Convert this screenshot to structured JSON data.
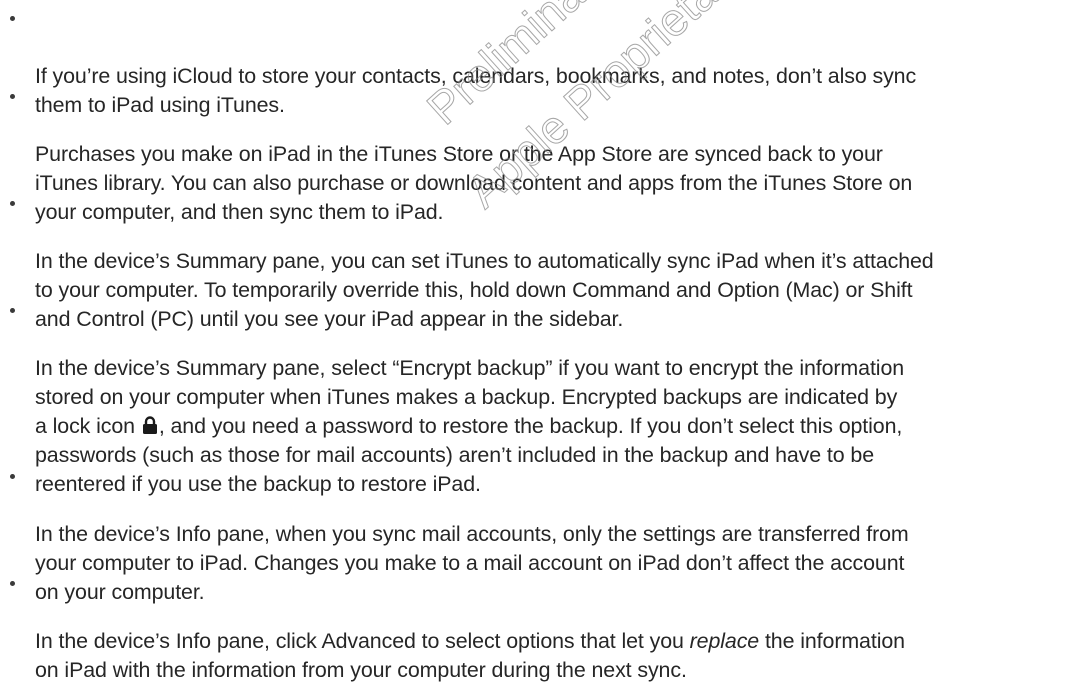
{
  "watermark": {
    "line1": "Preliminary",
    "line2": "Apple Proprietary"
  },
  "bullets": [
    {
      "text": "If you’re using iCloud to store your contacts, calendars, bookmarks, and notes, don’t also sync\nthem to iPad using iTunes."
    },
    {
      "text": "Purchases you make on iPad in the iTunes Store or the App Store are synced back to your\niTunes library. You can also purchase or download content and apps from the iTunes Store on\nyour computer, and then sync them to iPad."
    },
    {
      "text": "In the device’s Summary pane, you can set iTunes to automatically sync iPad when it’s attached\nto your computer. To temporarily override this, hold down Command and Option (Mac) or Shift\nand Control (PC) until you see your iPad appear in the sidebar."
    },
    {
      "text_before_icon": "In the device’s Summary pane, select “Encrypt backup” if you want to encrypt the information\nstored on your computer when iTunes makes a backup. Encrypted backups are indicated by\na lock icon ",
      "icon": "lock-icon",
      "text_after_icon": ", and you need a password to restore the backup. If you don’t select this option,\npasswords (such as those for mail accounts) aren’t included in the backup and have to be\nreentered if you use the backup to restore iPad."
    },
    {
      "text": "In the device’s Info pane, when you sync mail accounts, only the settings are transferred from\nyour computer to iPad. Changes you make to a mail account on iPad don’t affect the account\non your computer."
    },
    {
      "text_before_em": "In the device’s Info pane, click Advanced to select options that let you ",
      "em": "replace",
      "text_after_em": " the information\non iPad with the information from your computer during the next sync."
    }
  ]
}
